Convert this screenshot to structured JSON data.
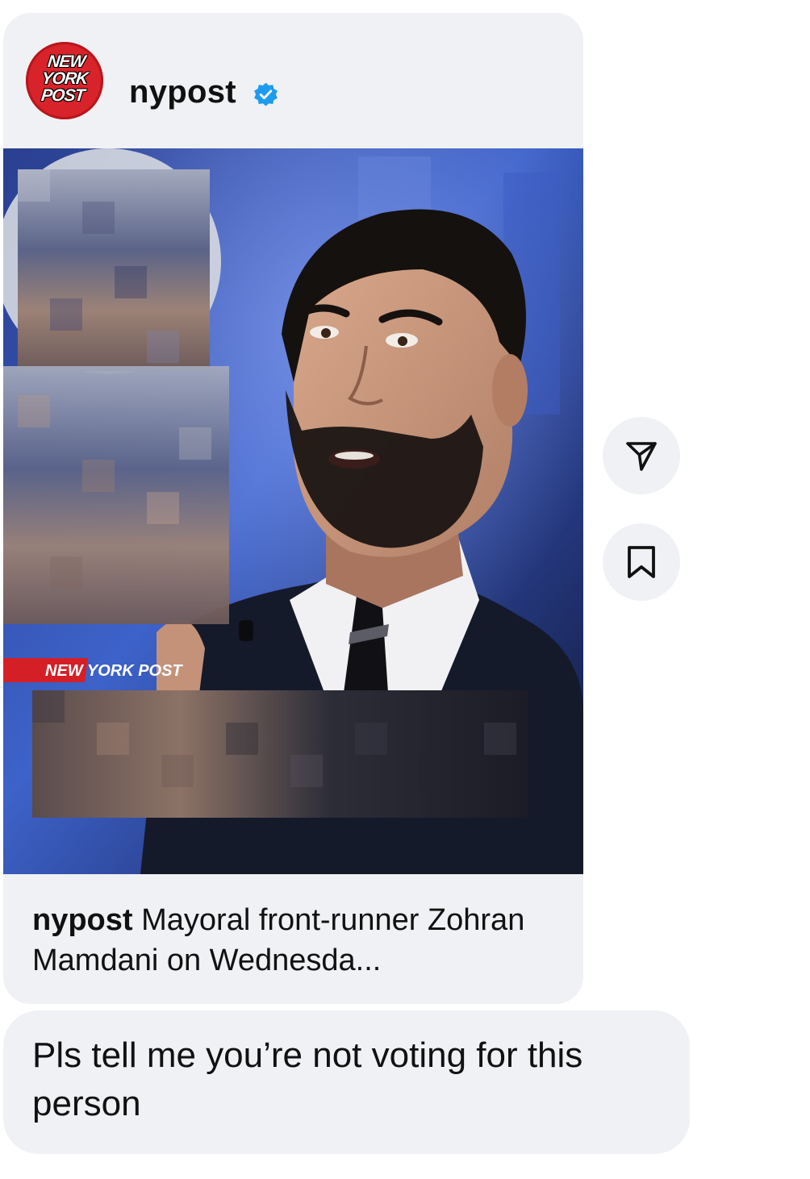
{
  "post": {
    "username": "nypost",
    "verified": true,
    "avatar_lines": [
      "NEW",
      "YORK",
      "POST"
    ],
    "image_overlay_label": "NEW YORK POST",
    "caption_username": "nypost",
    "caption_text": "Mayoral front-runner Zohran Mamdani on Wednesda..."
  },
  "actions": {
    "share_icon": "paper-plane-icon",
    "save_icon": "bookmark-icon"
  },
  "message": {
    "text": "Pls tell me you’re not voting for this person"
  },
  "colors": {
    "bubble_bg": "#eff1f4",
    "brand_red": "#d8232a",
    "verified_blue": "#1d9bf0"
  }
}
